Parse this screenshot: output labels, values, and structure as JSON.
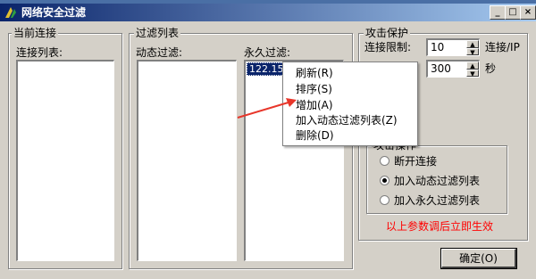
{
  "window": {
    "title": "网络安全过滤",
    "min_label": "_",
    "max_label": "□",
    "close_label": "×"
  },
  "current": {
    "group_title": "当前连接",
    "list_label": "连接列表:"
  },
  "filter": {
    "group_title": "过滤列表",
    "dynamic_label": "动态过滤:",
    "permanent_label": "永久过滤:",
    "permanent_items": [
      "122.158"
    ]
  },
  "attack": {
    "group_title": "攻击保护",
    "limit_label": "连接限制:",
    "limit_value": "10",
    "limit_unit": "连接/IP",
    "time_value": "300",
    "time_unit": "秒",
    "action_title": "攻击操作",
    "options": [
      {
        "label": "断开连接",
        "checked": false
      },
      {
        "label": "加入动态过滤列表",
        "checked": true
      },
      {
        "label": "加入永久过滤列表",
        "checked": false
      }
    ],
    "notice": "以上参数调后立即生效",
    "notice_color": "#ff0000"
  },
  "context_menu": {
    "items": [
      "刷新(R)",
      "排序(S)",
      "增加(A)",
      "加入动态过滤列表(Z)",
      "删除(D)"
    ]
  },
  "ok_button": "确定(O)",
  "arrow_color": "#e8362a"
}
